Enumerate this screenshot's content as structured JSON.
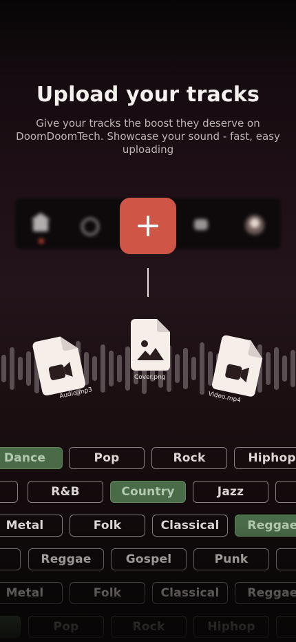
{
  "header": {
    "title": "Upload your tracks",
    "subtitle_lines": [
      "Give your tracks the boost they deserve on",
      "DoomDoomTech. Showcase your sound - fast, easy",
      "uploading"
    ]
  },
  "upload": {
    "plus_label": "+"
  },
  "files": {
    "audio": "Audio.mp3",
    "cover": "Cover.png",
    "video": "Video.mp4"
  },
  "genres": {
    "row1": [
      "Dance",
      "Pop",
      "Rock",
      "Hiphop"
    ],
    "row2": [
      "R&B",
      "Country",
      "Jazz"
    ],
    "row3": [
      "Metal",
      "Folk",
      "Classical",
      "Reggae"
    ],
    "row4": [
      "Reggae",
      "Gospel",
      "Punk"
    ],
    "row5": [
      "Metal",
      "Folk",
      "Classical",
      "Reggae"
    ],
    "row6": [
      "Pop",
      "Rock",
      "Hiphop"
    ],
    "selected": [
      "Dance",
      "Country",
      "Reggae"
    ]
  },
  "colors": {
    "accent": "#cf5546",
    "selected_chip": "#4a6b48",
    "chip_border": "#8a8282"
  }
}
